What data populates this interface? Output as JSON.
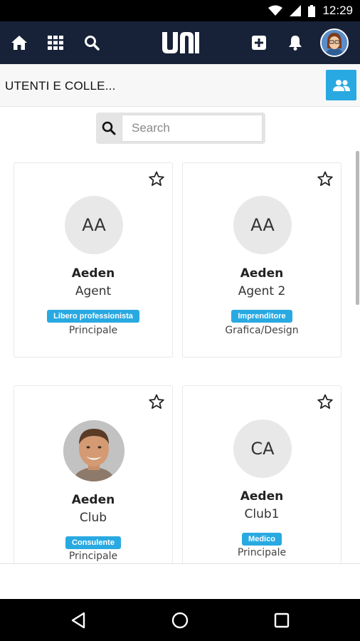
{
  "status": {
    "time": "12:29"
  },
  "app": {
    "logo_text": "uni",
    "colors": {
      "header": "#172238",
      "accent": "#29a9e1"
    }
  },
  "toolbar": {
    "icons": [
      "home-icon",
      "grid-icon",
      "search-icon",
      "add-icon",
      "bell-icon"
    ]
  },
  "subheader": {
    "title": "UTENTI E COLLE..."
  },
  "search": {
    "placeholder": "Search",
    "value": ""
  },
  "cards": [
    {
      "first": "Aeden",
      "last": "Agent",
      "initials": "AA",
      "badge": "Libero professionista",
      "sub": "Principale",
      "has_photo": false
    },
    {
      "first": "Aeden",
      "last": "Agent 2",
      "initials": "AA",
      "badge": "Imprenditore",
      "sub": "Grafica/Design",
      "has_photo": false
    },
    {
      "first": "Aeden",
      "last": "Club",
      "initials": "",
      "badge": "Consulente",
      "sub": "Principale",
      "has_photo": true
    },
    {
      "first": "Aeden",
      "last": "Club1",
      "initials": "CA",
      "badge": "Medico",
      "sub": "Principale",
      "has_photo": false
    }
  ]
}
